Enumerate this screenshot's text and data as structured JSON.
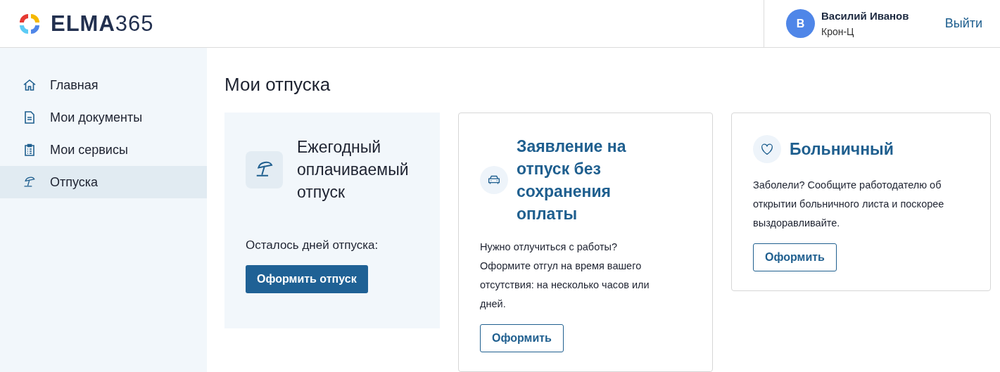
{
  "header": {
    "logo": {
      "brand": "ELMA",
      "suffix": "365"
    },
    "user": {
      "initial": "В",
      "name": "Василий Иванов",
      "company": "Крон-Ц"
    },
    "logout": "Выйти"
  },
  "sidebar": {
    "items": [
      {
        "label": "Главная",
        "selected": false
      },
      {
        "label": "Мои документы",
        "selected": false
      },
      {
        "label": "Мои сервисы",
        "selected": false
      },
      {
        "label": "Отпуска",
        "selected": true
      }
    ]
  },
  "page": {
    "title": "Мои отпуска"
  },
  "cards": [
    {
      "kind": "featured",
      "title": "Ежегодный оплачиваемый отпуск",
      "text": "Осталось дней отпуска:",
      "button": "Оформить отпуск"
    },
    {
      "kind": "outlined",
      "title": "Заявление на отпуск без сохранения оплаты",
      "text": "Нужно отлучиться с работы? Оформите отгул на время вашего отсутствия: на несколько часов или дней.",
      "button": "Оформить"
    },
    {
      "kind": "outlined",
      "title": "Больничный",
      "text": "Заболели? Сообщите работодателю об открытии больничного листа и поскорее выздоравливайте.",
      "button": "Оформить"
    }
  ]
}
